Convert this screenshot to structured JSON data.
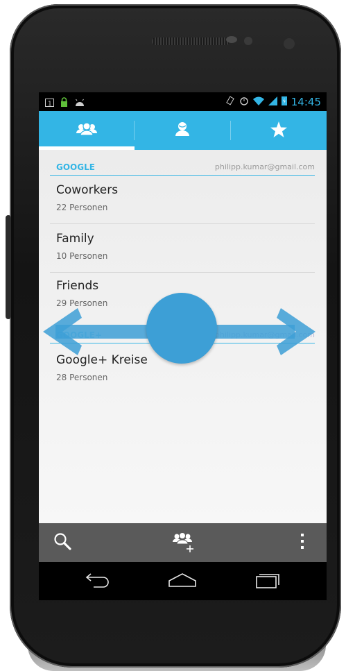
{
  "status_bar": {
    "time": "14:45"
  },
  "tabs": [
    {
      "id": "groups",
      "icon": "groups-icon",
      "selected": true
    },
    {
      "id": "contacts",
      "icon": "person-icon",
      "selected": false
    },
    {
      "id": "favorites",
      "icon": "star-icon",
      "selected": false
    }
  ],
  "sections": [
    {
      "title": "GOOGLE",
      "account": "philipp.kumar@gmail.com",
      "groups": [
        {
          "name": "Coworkers",
          "count": "22 Personen"
        },
        {
          "name": "Family",
          "count": "10 Personen"
        },
        {
          "name": "Friends",
          "count": "29 Personen"
        }
      ]
    },
    {
      "title": "GOOGLE+",
      "account": "philipp.kumar@gmail.com",
      "groups": [
        {
          "name": "Google+ Kreise",
          "count": "28 Personen"
        }
      ]
    }
  ],
  "action_bar": {
    "icons": [
      "search-icon",
      "add-group-icon",
      "overflow-menu-icon"
    ]
  },
  "nav_bar": {
    "icons": [
      "back-icon",
      "home-icon",
      "recent-apps-icon"
    ]
  },
  "gesture_hint": {
    "type": "swipe-left-right",
    "color": "#3d9fd6"
  },
  "colors": {
    "accent": "#33b5e5",
    "action_bar": "#5a5a5a",
    "hint": "#3d9fd6"
  }
}
